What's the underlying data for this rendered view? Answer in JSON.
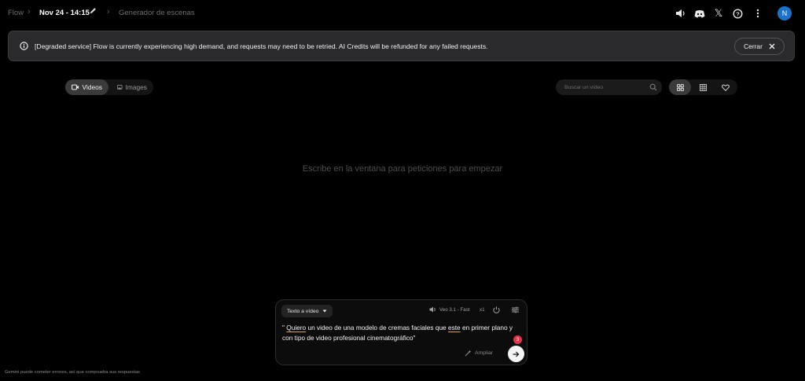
{
  "breadcrumb": {
    "app": "Flow",
    "project": "Nov 24 - 14:15",
    "scene": "Generador de escenas"
  },
  "header_icons": [
    "announcement-icon",
    "discord-icon",
    "x-logo-icon",
    "help-icon",
    "more-vert-icon"
  ],
  "user": {
    "initial": "N",
    "avatar_color": "#1a73c8"
  },
  "banner": {
    "text": "[Degraded service] Flow is currently experiencing high demand, and requests may need to be retried. AI Credits will be refunded for any failed requests.",
    "close_label": "Cerrar"
  },
  "media_tabs": [
    {
      "label": "Videos",
      "icon": "video-icon",
      "active": true
    },
    {
      "label": "Images",
      "icon": "image-icon",
      "active": false
    }
  ],
  "search": {
    "placeholder": "Buscar un vídeo"
  },
  "view_modes": [
    {
      "icon": "grid-icon",
      "active": true
    },
    {
      "icon": "grid-dense-icon",
      "active": false
    },
    {
      "icon": "heart-icon",
      "active": false
    }
  ],
  "empty_state": "Escribe en la ventana para peticiones para empezar",
  "composer": {
    "mode": "Texto a vídeo",
    "model": "Veo 3.1 - Fast",
    "count": "x1",
    "prompt_parts": {
      "p1": "\" ",
      "p2": "Quiero",
      "p3": " un video de una modelo de cremas faciales que ",
      "p4": "este",
      "p5": " en primer plano y con tipo de video profesional cinematográfico",
      "p6": "\"",
      "p7": " "
    },
    "spelling_issues": "3",
    "expand_label": "Ampliar"
  },
  "footer": "Gemini puede cometer errores, así que comprueba sus respuestas",
  "colors": {
    "accent_badge": "#e5334b",
    "banner_bg": "#2a2a2c",
    "background": "#000000"
  }
}
